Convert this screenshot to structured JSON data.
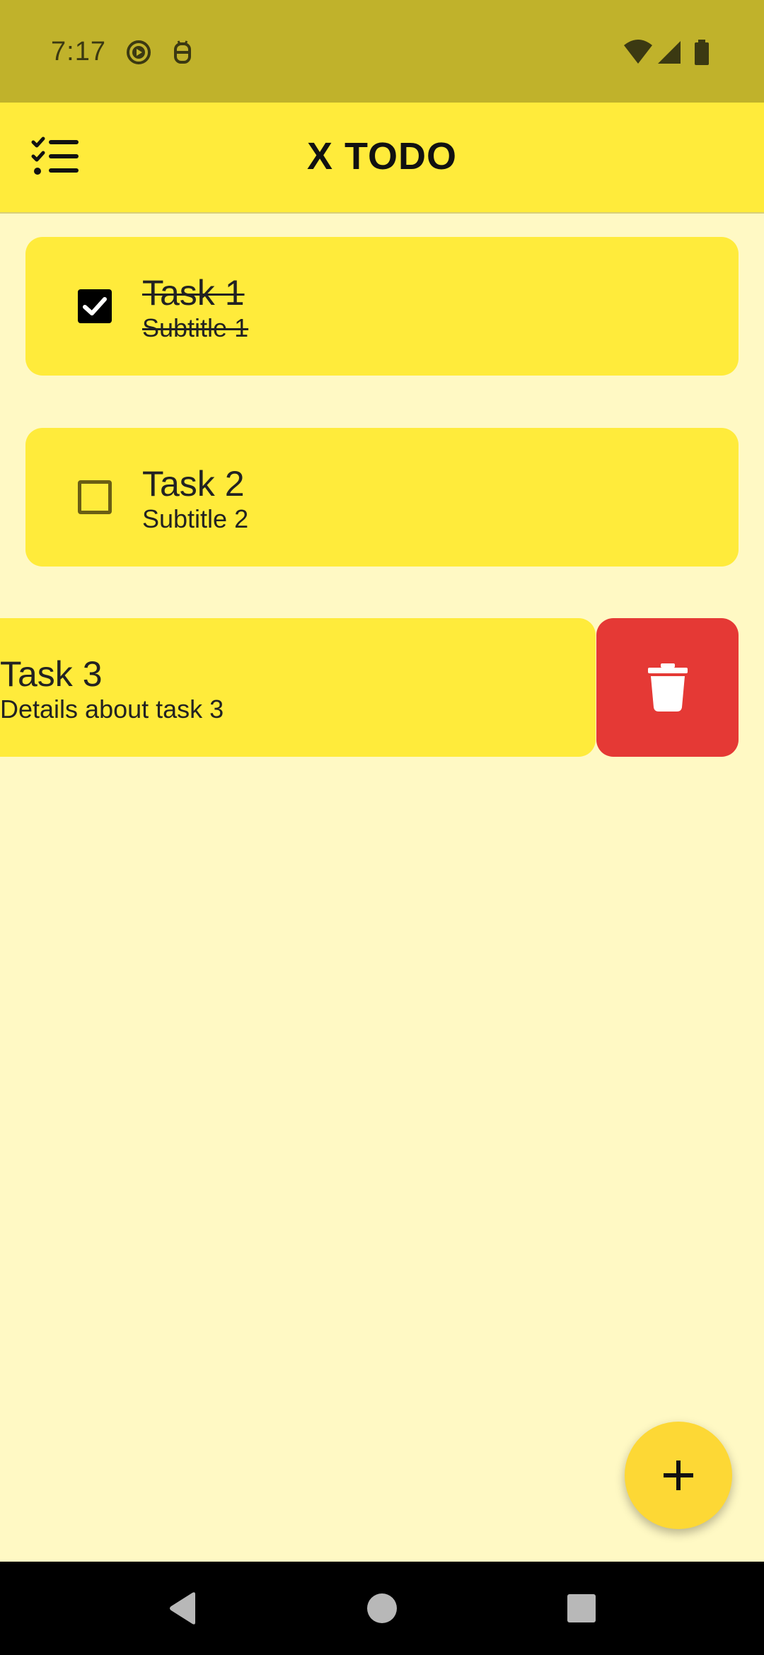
{
  "status_bar": {
    "time": "7:17",
    "icons": [
      "media-play-icon",
      "debug-robot-icon",
      "wifi-icon",
      "cell-signal-icon",
      "battery-icon"
    ]
  },
  "app_bar": {
    "title": "X TODO",
    "menu_icon": "checklist-icon"
  },
  "tasks": [
    {
      "title": "Task 1",
      "subtitle": "Subtitle 1",
      "completed": true
    },
    {
      "title": "Task 2",
      "subtitle": "Subtitle 2",
      "completed": false
    },
    {
      "title": "Task 3",
      "subtitle": "Details about task 3",
      "completed": false,
      "swiped_for_delete": true
    }
  ],
  "delete_action": {
    "icon": "trash-icon"
  },
  "fab": {
    "icon": "plus-icon"
  },
  "nav_bar": {
    "icons": [
      "back-icon",
      "home-icon",
      "recents-icon"
    ]
  },
  "colors": {
    "status_bar": "#C0B22B",
    "app_bar": "#FFEB3B",
    "background": "#FFF9C4",
    "card": "#FFEB3B",
    "delete": "#E53935",
    "fab": "#FDD835"
  }
}
